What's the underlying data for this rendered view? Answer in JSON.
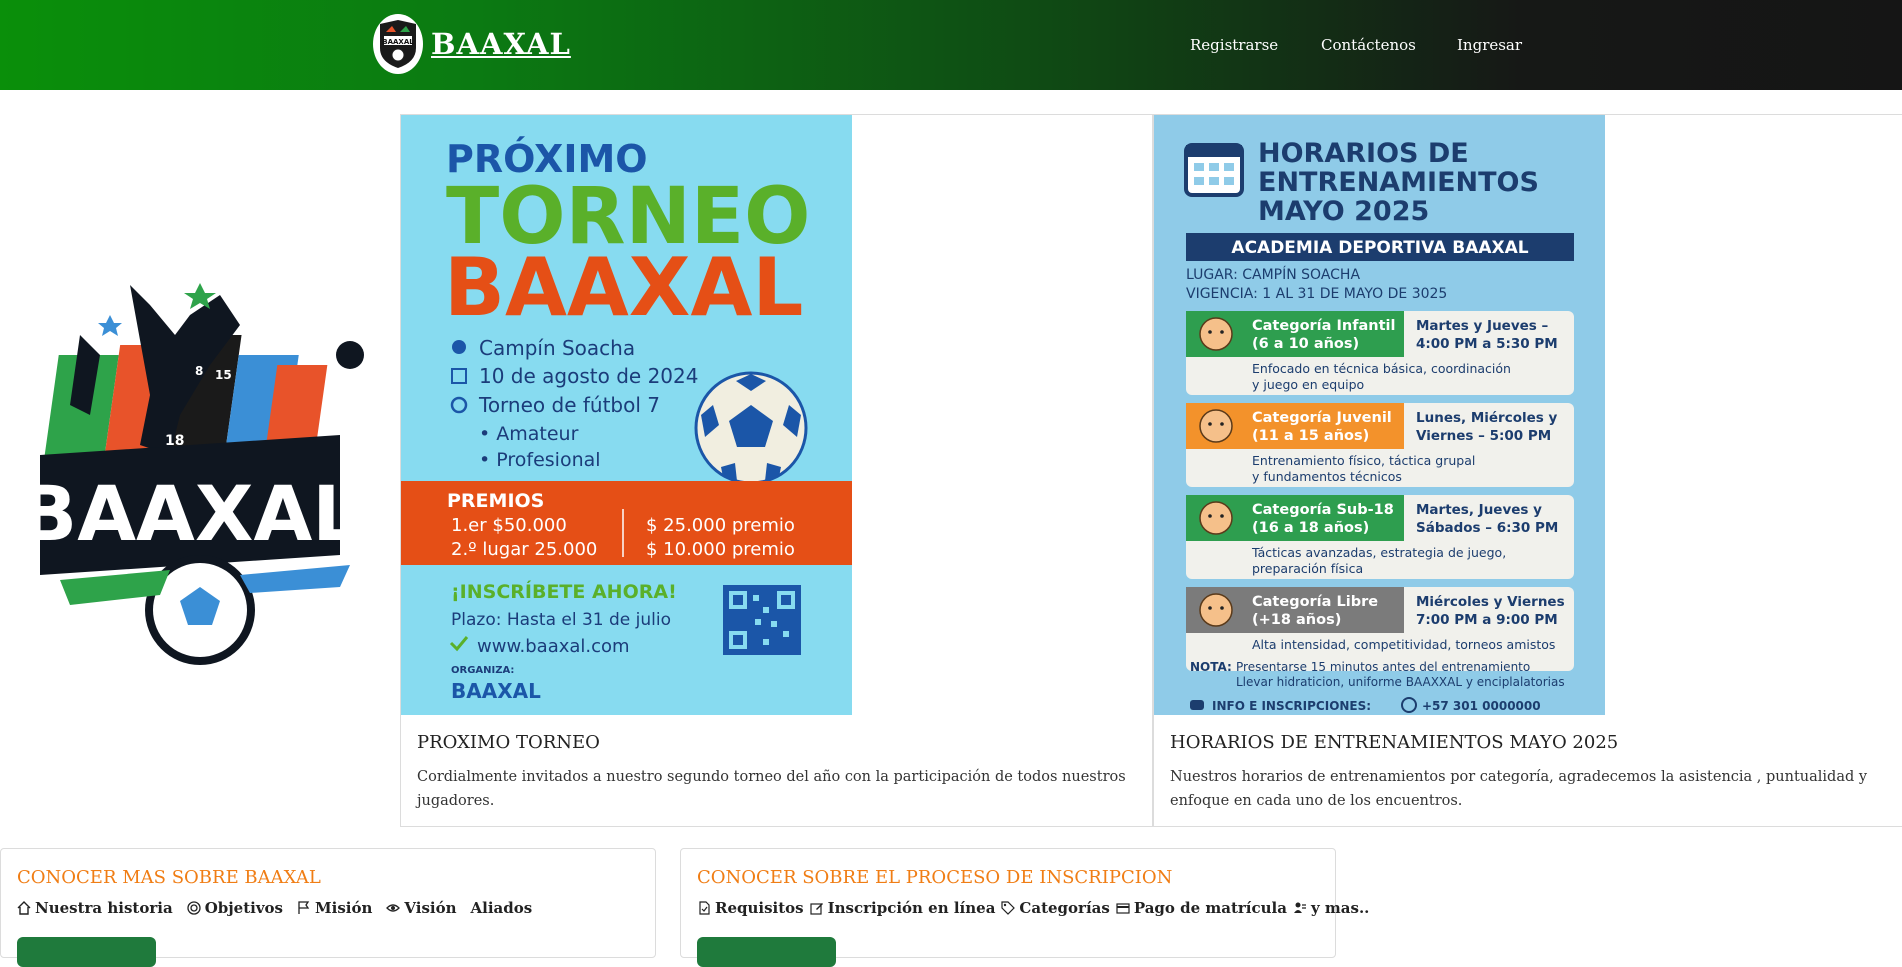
{
  "nav": {
    "brand": "BAAXAL",
    "links": [
      "Registrarse",
      "Contáctenos",
      "Ingresar"
    ]
  },
  "hero_logo": {
    "text": "BAAXAL",
    "jersey_numbers": [
      "8",
      "15",
      "18"
    ]
  },
  "cards": [
    {
      "title": "PROXIMO TORNEO",
      "text": "Cordialmente invitados a nuestro segundo torneo del año con la participación de todos nuestros jugadores.",
      "poster": {
        "line1": "PRÓXIMO",
        "line2": "TORNEO",
        "line3": "BAAXAL",
        "place": "Campín Soacha",
        "date": "10 de agosto de 2024",
        "type": "Torneo de fútbol 7",
        "cat1": "• Amateur",
        "cat2": "• Profesional",
        "prizes_label": "PREMIOS",
        "p1": "1.er    $50.000",
        "p2": "2.º lugar 25.000",
        "p3": "$ 25.000 premio",
        "p4": "$ 10.000 premio",
        "cta": "¡INSCRÍBETE AHORA!",
        "deadline": "Plazo: Hasta el 31 de julio",
        "web": "www.baaxal.com",
        "org_label": "ORGANIZA:",
        "org": "BAAXAL"
      }
    },
    {
      "title": "HORARIOS DE ENTRENAMIENTOS MAYO 2025",
      "text": "Nuestros horarios de entrenamientos por categoría, agradecemos la asistencia , puntualidad y enfoque en cada uno de los encuentros.",
      "poster": {
        "h1": "HORARIOS DE",
        "h2": "ENTRENAMIENTOS",
        "h3": "MAYO 2025",
        "academy": "ACADEMIA DEPORTIVA BAAXAL",
        "place": "LUGAR: CAMPÍN SOACHA",
        "validity": "VIGENCIA: 1 AL 31 DE MAYO DE 3025",
        "rows": [
          {
            "cat": "Categoría Infantil",
            "age": "(6 a 10 años)",
            "t1": "Martes y Jueves –",
            "t2": "4:00 PM a 5:30 PM",
            "d1": "Enfocado en técnica básica, coordinación",
            "d2": "y juego en equipo",
            "color": "#2e9e4f"
          },
          {
            "cat": "Categoría Juvenil",
            "age": "(11 a 15 años)",
            "t1": "Lunes, Miércoles y",
            "t2": "Viernes – 5:00 PM",
            "d1": "Entrenamiento físico, táctica grupal",
            "d2": "y fundamentos técnicos",
            "color": "#f3922b"
          },
          {
            "cat": "Categoría Sub-18",
            "age": "(16 a 18 años)",
            "t1": "Martes, Jueves y",
            "t2": "Sábados – 6:30 PM",
            "d1": "Tácticas avanzadas, estrategia de juego,",
            "d2": "preparación física",
            "color": "#2e9e4f"
          },
          {
            "cat": "Categoría Libre",
            "age": "(+18 años)",
            "t1": "Miércoles y Viernes",
            "t2": "7:00 PM a 9:00 PM",
            "d1": "Alta intensidad, competitividad, torneos amistos",
            "d2": "",
            "color": "#7b7b7b"
          }
        ],
        "note_label": "NOTA:",
        "note1": "Presentarse 15 minutos antes del entrenamiento",
        "note2": "Llevar hidraticion, uniforme BAAXXAL y enciplalatorias",
        "info": "INFO E INSCRIPCIONES:",
        "phone": "+57 301 0000000"
      }
    }
  ],
  "info_sections": [
    {
      "title": "CONOCER MAS SOBRE BAAXAL",
      "links": [
        {
          "icon": "house-icon",
          "label": "Nuestra historia"
        },
        {
          "icon": "target-icon",
          "label": "Objetivos"
        },
        {
          "icon": "flag-icon",
          "label": "Misión"
        },
        {
          "icon": "eye-icon",
          "label": "Visión"
        },
        {
          "icon": "",
          "label": "Aliados"
        }
      ]
    },
    {
      "title": "CONOCER SOBRE EL PROCESO DE INSCRIPCION",
      "links": [
        {
          "icon": "document-check-icon",
          "label": "Requisitos"
        },
        {
          "icon": "pencil-square-icon",
          "label": "Inscripción en línea"
        },
        {
          "icon": "tag-icon",
          "label": "Categorías"
        },
        {
          "icon": "credit-card-icon",
          "label": "Pago de matrícula"
        },
        {
          "icon": "people-icon",
          "label": "y mas.."
        }
      ]
    }
  ],
  "colors": {
    "nav_start": "#0a8f0a",
    "nav_end": "#151515",
    "accent_orange": "#f07d14",
    "button_green": "#1f7a3c"
  }
}
